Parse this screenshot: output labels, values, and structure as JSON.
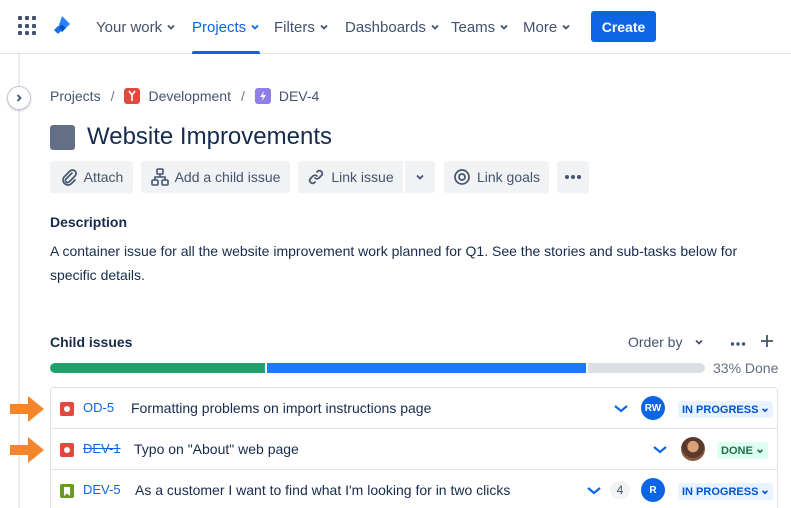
{
  "nav": {
    "items": [
      {
        "label": "Your work",
        "active": false
      },
      {
        "label": "Projects",
        "active": true
      },
      {
        "label": "Filters",
        "active": false
      },
      {
        "label": "Dashboards",
        "active": false
      },
      {
        "label": "Teams",
        "active": false
      },
      {
        "label": "More",
        "active": false
      }
    ],
    "create_label": "Create"
  },
  "breadcrumb": {
    "root": "Projects",
    "project": "Development",
    "issue": "DEV-4"
  },
  "issue": {
    "title": "Website Improvements"
  },
  "actions": {
    "attach": "Attach",
    "add_child": "Add a child issue",
    "link_issue": "Link issue",
    "link_goals": "Link goals"
  },
  "description": {
    "label": "Description",
    "text": "A container issue for all the website improvement work planned for Q1. See the stories and sub-tasks below for specific details."
  },
  "child_issues": {
    "label": "Child issues",
    "order_by": "Order by",
    "progress": {
      "done": 0.33,
      "in_progress": 0.49,
      "todo": 0.18
    },
    "progress_text": "33% Done",
    "items": [
      {
        "key": "OD-5",
        "summary": "Formatting problems on import instructions page",
        "type": "bug",
        "assignee": "RW",
        "status": "IN PROGRESS",
        "count": ""
      },
      {
        "key": "DEV-1",
        "summary": "Typo on \"About\" web page",
        "type": "bug",
        "assignee": "",
        "status": "DONE",
        "count": ""
      },
      {
        "key": "DEV-5",
        "summary": "As a customer I want to find what I'm looking for in two clicks",
        "type": "story",
        "assignee": "R",
        "status": "IN PROGRESS",
        "count": "4"
      }
    ]
  },
  "colors": {
    "brand": "#0c66e4",
    "done": "#22a06b",
    "in_progress": "#1d7afc",
    "bug": "#e2483d",
    "story": "#6a9a23",
    "annotation_arrow": "#f5852a"
  }
}
